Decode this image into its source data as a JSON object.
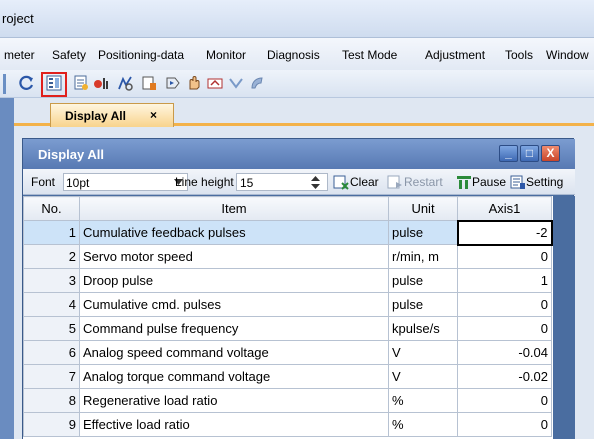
{
  "app": {
    "title_fragment": "roject"
  },
  "menu": [
    "meter",
    "Safety",
    "Positioning-data",
    "Monitor",
    "Diagnosis",
    "Test Mode",
    "Adjustment",
    "Tools",
    "Window"
  ],
  "toolbar": {
    "icons": [
      "refresh-icon",
      "display-all-icon",
      "monitor-graph-icon",
      "io-monitor-icon",
      "alarm-display-icon",
      "drive-recorder-icon",
      "test-operation-icon",
      "jog-icon",
      "positioning-icon",
      "motor-drive-icon",
      "machine-analyzer-icon"
    ],
    "highlighted": "display-all-icon"
  },
  "doc_tab": {
    "label": "Display All",
    "close": "×"
  },
  "window": {
    "title": "Display All",
    "buttons": {
      "minimize": "_",
      "maximize": "□",
      "close": "X"
    },
    "controls": {
      "font_label": "Font",
      "font_value": "10pt",
      "line_height_label": "Line height",
      "line_height_value": "15",
      "clear_label": "Clear",
      "restart_label": "Restart",
      "pause_label": "Pause",
      "setting_label": "Setting"
    }
  },
  "table": {
    "headers": [
      "No.",
      "Item",
      "Unit",
      "Axis1"
    ],
    "rows": [
      {
        "no": "1",
        "item": "Cumulative feedback pulses",
        "unit": "pulse",
        "axis1": "-2"
      },
      {
        "no": "2",
        "item": "Servo motor speed",
        "unit": "r/min, m",
        "axis1": "0"
      },
      {
        "no": "3",
        "item": "Droop pulse",
        "unit": "pulse",
        "axis1": "1"
      },
      {
        "no": "4",
        "item": "Cumulative cmd. pulses",
        "unit": "pulse",
        "axis1": "0"
      },
      {
        "no": "5",
        "item": "Command pulse frequency",
        "unit": "kpulse/s",
        "axis1": "0"
      },
      {
        "no": "6",
        "item": "Analog speed command voltage",
        "unit": "V",
        "axis1": "-0.04"
      },
      {
        "no": "7",
        "item": "Analog torque command voltage",
        "unit": "V",
        "axis1": "-0.02"
      },
      {
        "no": "8",
        "item": "Regenerative load ratio",
        "unit": "%",
        "axis1": "0"
      },
      {
        "no": "9",
        "item": "Effective load ratio",
        "unit": "%",
        "axis1": "0"
      }
    ]
  },
  "colors": {
    "accent": "#f3b24a",
    "highlight_box": "#e0201c",
    "selection": "#cde3f8",
    "window_title": "#5779b3"
  }
}
